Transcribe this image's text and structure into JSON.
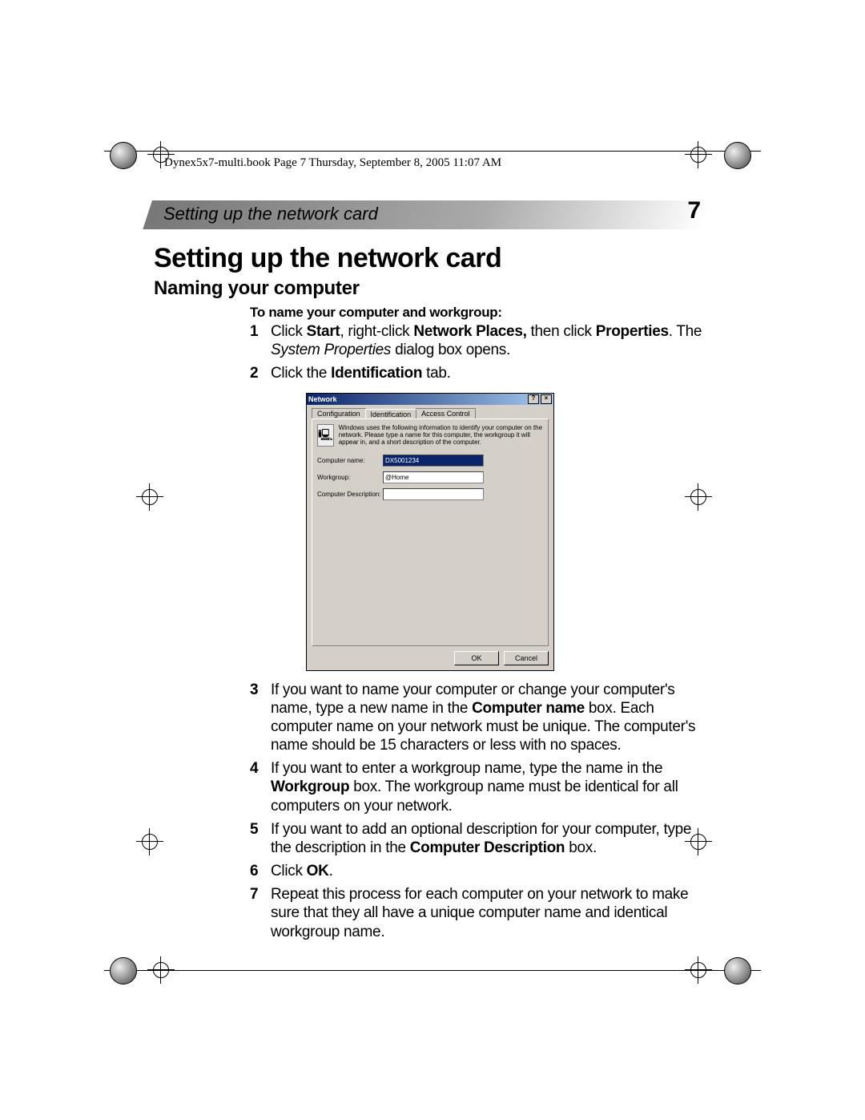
{
  "meta": {
    "header": "Dynex5x7-multi.book  Page 7  Thursday, September 8, 2005  11:07 AM"
  },
  "running_head": "Setting up the network card",
  "page_number": "7",
  "title": "Setting up the network card",
  "subtitle": "Naming your computer",
  "lead": "To name your computer and workgroup:",
  "steps": {
    "s1": {
      "num": "1",
      "t1": "Click ",
      "b1": "Start",
      "t2": ", right-click ",
      "b2": "Network Places,",
      "t3": " then click ",
      "b3": "Properties",
      "t4": ". The ",
      "i1": "System Properties",
      "t5": " dialog box opens."
    },
    "s2": {
      "num": "2",
      "t1": "Click the ",
      "b1": "Identification",
      "t2": " tab."
    },
    "s3": {
      "num": "3",
      "t1": "If you want to name your computer or change your computer's name, type a new name in the ",
      "b1": "Computer name",
      "t2": " box. Each computer name on your network must be unique. The computer's name should be 15 characters or less with no spaces."
    },
    "s4": {
      "num": "4",
      "t1": "If you want to enter a workgroup name, type the name in the ",
      "b1": "Workgroup",
      "t2": " box. The workgroup name must be identical for all computers on your network."
    },
    "s5": {
      "num": "5",
      "t1": "If you want to add an optional description for your computer, type the description in the ",
      "b1": "Computer Description",
      "t2": " box."
    },
    "s6": {
      "num": "6",
      "t1": "Click ",
      "b1": "OK",
      "t2": "."
    },
    "s7": {
      "num": "7",
      "t1": "Repeat this process for each computer on your network to make sure that they all have a unique computer name and identical workgroup name."
    }
  },
  "dialog": {
    "title": "Network",
    "help_btn": "?",
    "close_btn": "×",
    "tabs": {
      "configuration": "Configuration",
      "identification": "Identification",
      "access_control": "Access Control"
    },
    "info_text": "Windows uses the following information to identify your computer on the network. Please type a name for this computer, the workgroup it will appear in, and a short description of the computer.",
    "labels": {
      "computer_name": "Computer name:",
      "workgroup": "Workgroup:",
      "description": "Computer Description:"
    },
    "values": {
      "computer_name": "DX5001234",
      "workgroup": "@Home",
      "description": ""
    },
    "buttons": {
      "ok": "OK",
      "cancel": "Cancel"
    },
    "info_icon": "🖳"
  }
}
